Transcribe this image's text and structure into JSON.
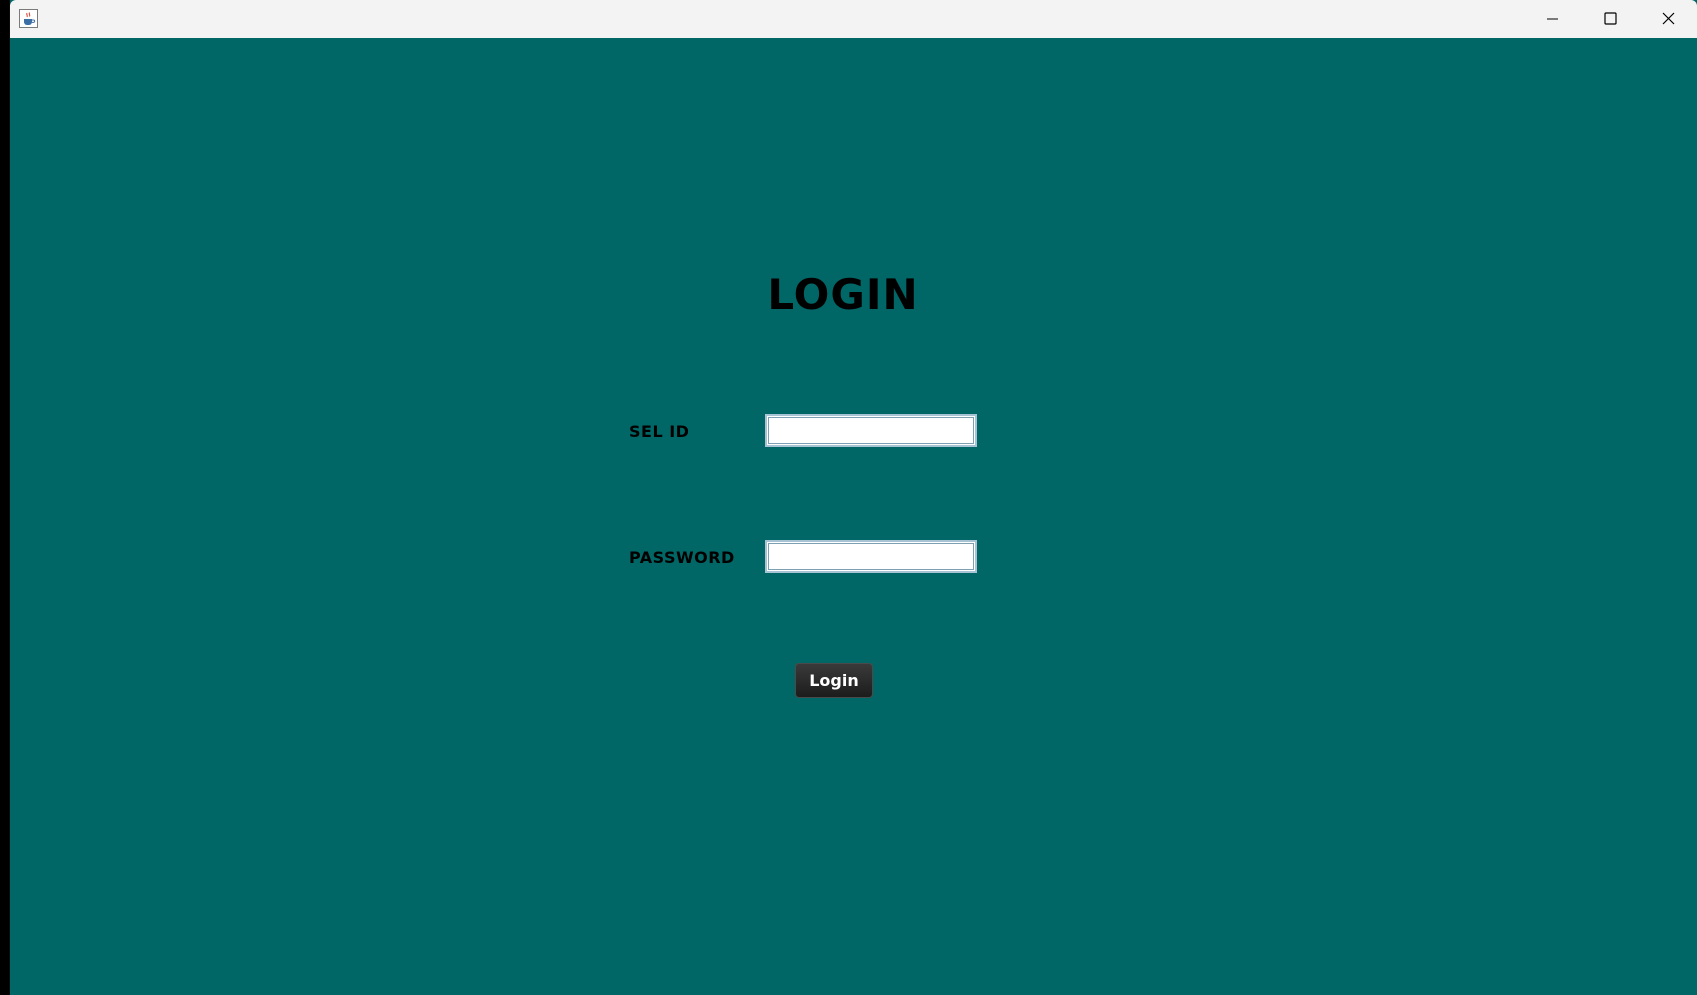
{
  "window": {
    "title": "",
    "app_icon": "java-cup-icon",
    "controls": [
      "minimize-icon",
      "maximize-icon",
      "close-icon"
    ],
    "background_color": "#006666"
  },
  "form": {
    "title": "LOGIN",
    "sel_id_label": "SEL ID",
    "sel_id_value": "",
    "password_label": "PASSWORD",
    "password_value": "",
    "login_button": "Login"
  }
}
